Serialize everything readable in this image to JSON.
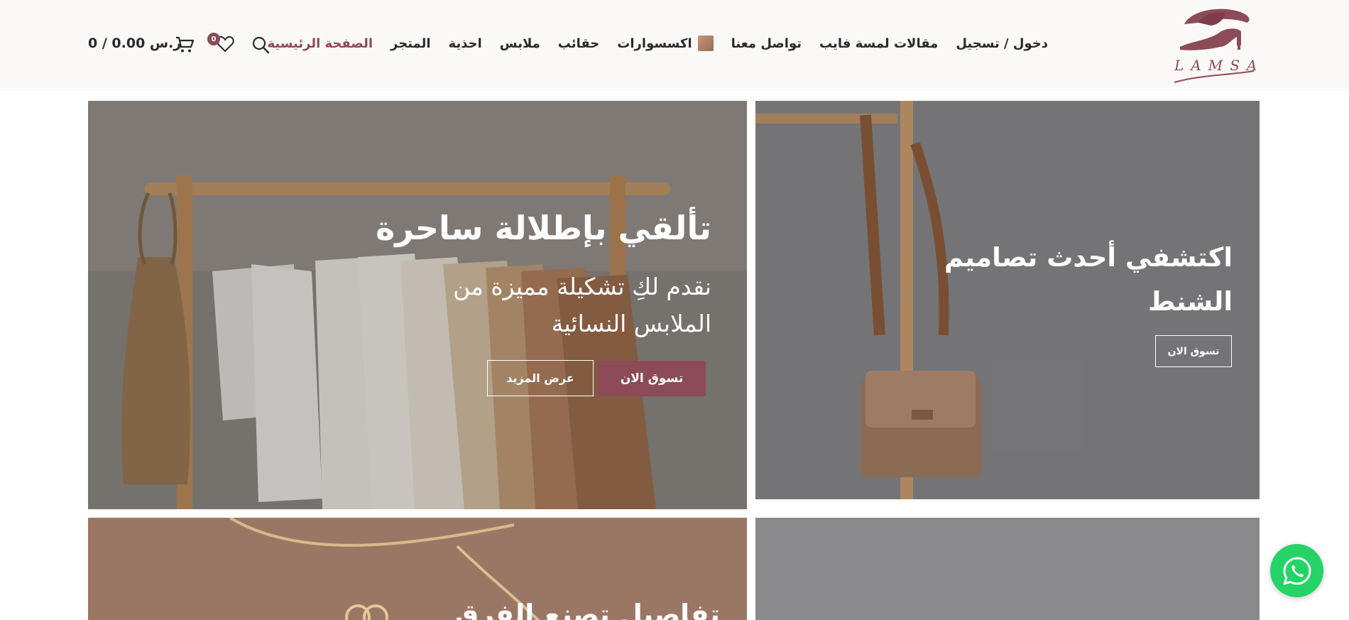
{
  "header": {
    "logo_text": "LAMSA",
    "nav": [
      {
        "label": "الصفحة الرئيسية",
        "active": true
      },
      {
        "label": "المتجر"
      },
      {
        "label": "احذية"
      },
      {
        "label": "ملابس"
      },
      {
        "label": "حقائب"
      },
      {
        "label": "اكسسوارات"
      },
      {
        "label": "تواصل معنا"
      },
      {
        "label": "مقالات لمسة فايب"
      },
      {
        "label": "دخول / تسجيل"
      }
    ],
    "wishlist_count": "0",
    "cart_summary": "ر.س 0.00 / 0",
    "accent_color": "#8c4b57"
  },
  "banners": {
    "main": {
      "title": "تألقي بإطلالة ساحرة",
      "subtitle": "نقدم لكِ تشكيلة مميزة من الملابس النسائية",
      "primary_button": "تسوق الان",
      "secondary_button": "عرض المزيد"
    },
    "bags": {
      "title": "اكتشفي أحدث تصاميم الشنط",
      "button": "تسوق الان"
    },
    "accessories": {
      "title": "تفاصيل تصنع الفرق"
    }
  },
  "icons": {
    "search": "search-icon",
    "wishlist": "heart-icon",
    "cart": "cart-icon",
    "whatsapp": "whatsapp-icon"
  }
}
